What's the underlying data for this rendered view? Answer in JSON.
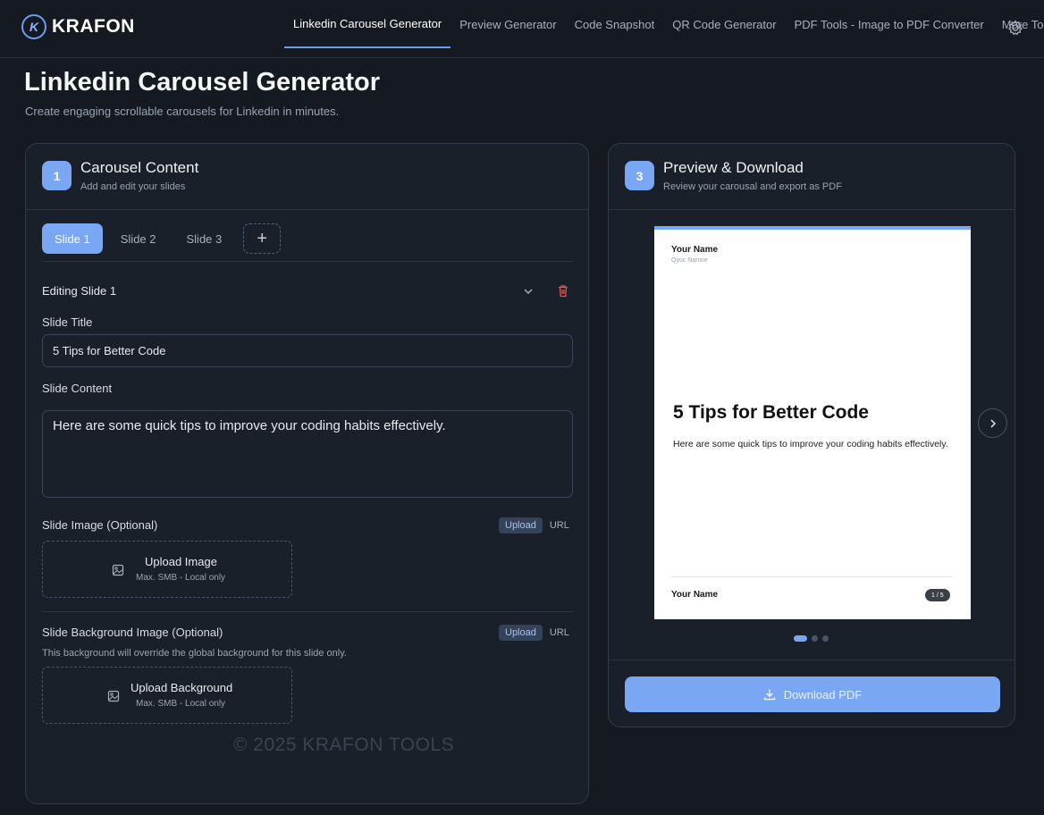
{
  "brand": {
    "name": "KRAFON",
    "logo_glyph": "K"
  },
  "nav": {
    "items": [
      {
        "label": "Linkedin Carousel Generator",
        "active": true
      },
      {
        "label": "Preview Generator",
        "active": false
      },
      {
        "label": "Code Snapshot",
        "active": false
      },
      {
        "label": "QR Code Generator",
        "active": false
      },
      {
        "label": "PDF Tools - Image to PDF Converter",
        "active": false
      }
    ],
    "more_label": "More Tools",
    "settings_icon": "gear-icon"
  },
  "header": {
    "title": "Linkedin Carousel Generator",
    "subtitle": "Create engaging scrollable carousels for Linkedin in minutes."
  },
  "content_panel": {
    "step": "1",
    "title": "Carousel Content",
    "subtitle": "Add and edit your slides",
    "tabs": [
      "Slide 1",
      "Slide 2",
      "Slide 3"
    ],
    "active_tab": "Slide 1",
    "add_glyph": "+",
    "editing_label": "Editing Slide 1",
    "slide_title_label": "Slide Title",
    "slide_title_value": "5 Tips for Better Code",
    "slide_content_label": "Slide Content",
    "slide_content_value": "Here are some quick tips to improve your coding habits effectively.",
    "image_label": "Slide Image (Optional)",
    "upload_label": "Upload",
    "url_label": "URL",
    "upload_image_title": "Upload Image",
    "upload_image_sub": "Max. SMB - Local only",
    "bg_label": "Slide Background Image (Optional)",
    "bg_note": "This background will override the global background for this slide only.",
    "upload_bg_title": "Upload Background",
    "upload_bg_sub": "Max. SMB - Local only",
    "watermark": "© 2025 KRAFON TOOLS"
  },
  "preview_panel": {
    "step": "3",
    "title": "Preview & Download",
    "subtitle": "Review your carousal and export as PDF",
    "card": {
      "name": "Your Name",
      "handle": "Qyoc Namoe",
      "title": "5 Tips for Better Code",
      "body": "Here are some quick tips to improve your coding habits effectively.",
      "footer_name": "Your Name",
      "page": "1 / 5"
    },
    "download_label": "Download PDF"
  },
  "colors": {
    "accent": "#7aa7f4",
    "background": "#151a22",
    "panel": "#1a2029",
    "danger": "#e05555"
  }
}
